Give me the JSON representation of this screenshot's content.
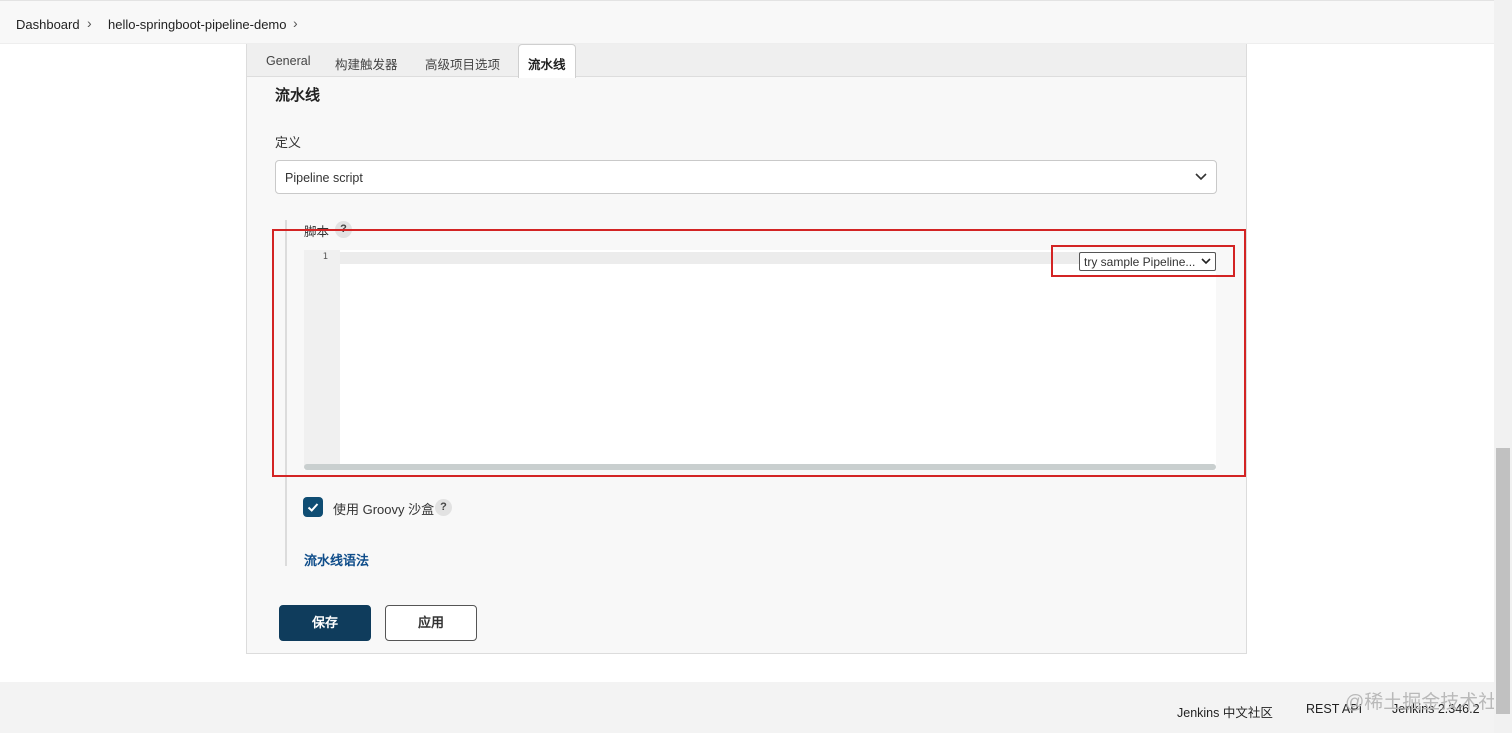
{
  "breadcrumb": {
    "items": [
      "Dashboard",
      "hello-springboot-pipeline-demo"
    ]
  },
  "tabs": [
    "General",
    "构建触发器",
    "高级项目选项",
    "流水线"
  ],
  "active_tab": "流水线",
  "pipeline": {
    "section_title": "流水线",
    "definition_label": "定义",
    "definition_value": "Pipeline script",
    "script_label": "脚本",
    "line_number": "1",
    "sample_select_value": "try sample Pipeline...",
    "groovy_sandbox_label": "使用 Groovy 沙盒",
    "groovy_sandbox_checked": true,
    "syntax_link": "流水线语法",
    "help_glyph": "?"
  },
  "buttons": {
    "save": "保存",
    "apply": "应用"
  },
  "footer": {
    "community": "Jenkins 中文社区",
    "rest_api": "REST API",
    "version": "Jenkins 2.346.2"
  },
  "watermark": "@稀土掘金技术社区",
  "colors": {
    "primary_button": "#0f3c5c",
    "checkbox": "#0f4d73",
    "link": "#0f4d8a",
    "highlight": "#d32424"
  }
}
